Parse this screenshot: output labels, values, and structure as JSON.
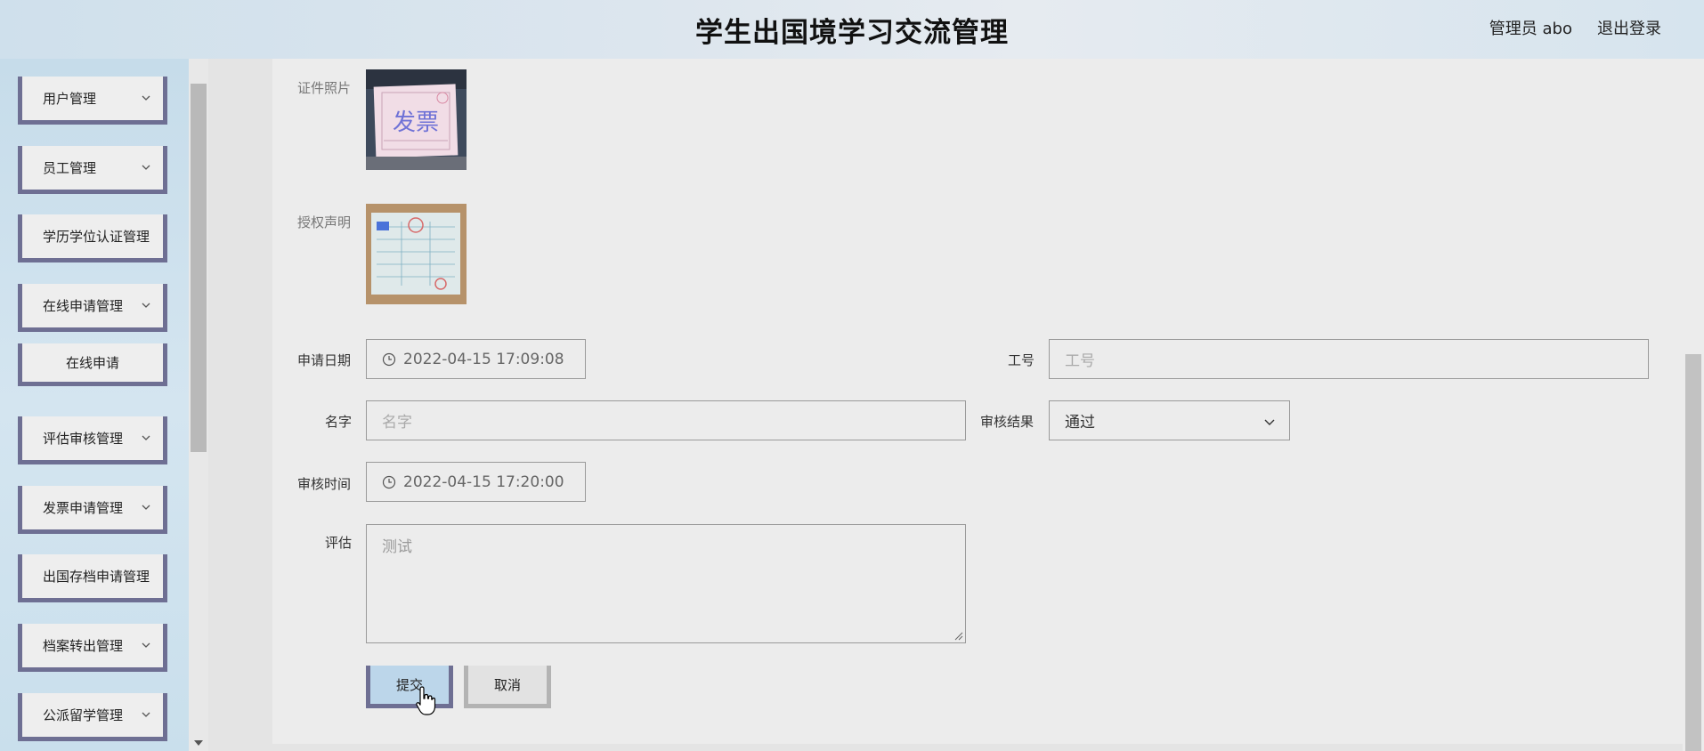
{
  "header": {
    "title": "学生出国境学习交流管理",
    "user": "管理员 abo",
    "logout": "退出登录"
  },
  "sidebar": {
    "items": [
      {
        "label": "用户管理",
        "expandable": true
      },
      {
        "label": "员工管理",
        "expandable": true
      },
      {
        "label": "学历学位认证管理",
        "expandable": false
      },
      {
        "label": "在线申请管理",
        "expandable": true
      },
      {
        "label": "在线申请",
        "expandable": false,
        "sub": true
      },
      {
        "label": "评估审核管理",
        "expandable": true
      },
      {
        "label": "发票申请管理",
        "expandable": true
      },
      {
        "label": "出国存档申请管理",
        "expandable": false
      },
      {
        "label": "档案转出管理",
        "expandable": true
      },
      {
        "label": "公派留学管理",
        "expandable": true
      }
    ]
  },
  "form": {
    "id_photo_label": "证件照片",
    "id_photo_icon": "invoice-photo",
    "auth_label": "授权声明",
    "auth_icon": "receipt-photo",
    "apply_date_label": "申请日期",
    "apply_date_value": "2022-04-15 17:09:08",
    "job_no_label": "工号",
    "job_no_placeholder": "工号",
    "name_label": "名字",
    "name_placeholder": "名字",
    "review_result_label": "审核结果",
    "review_result_value": "通过",
    "review_time_label": "审核时间",
    "review_time_value": "2022-04-15 17:20:00",
    "eval_label": "评估",
    "eval_value": "测试",
    "photo_text": "发票"
  },
  "actions": {
    "submit": "提交",
    "cancel": "取消"
  },
  "colors": {
    "accent": "#6e6f93",
    "submit_bg": "#bcd6ea"
  }
}
